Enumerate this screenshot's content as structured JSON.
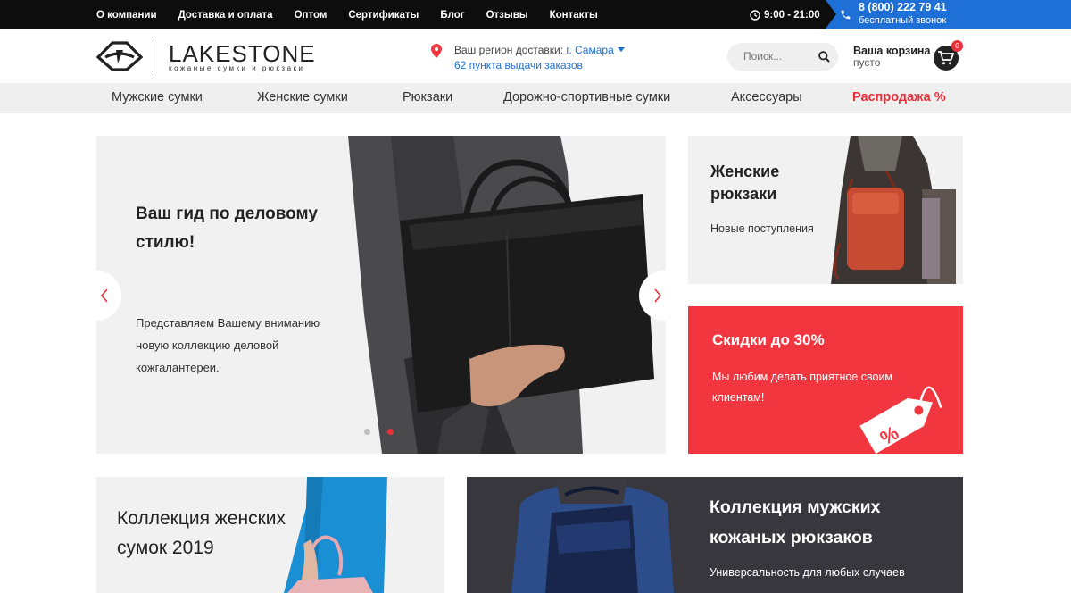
{
  "topbar": {
    "links": [
      "О компании",
      "Доставка и оплата",
      "Оптом",
      "Сертификаты",
      "Блог",
      "Отзывы",
      "Контакты"
    ],
    "hours": "9:00 - 21:00",
    "phone": "8 (800) 222 79 41",
    "phone_sub": "бесплатный звонок"
  },
  "header": {
    "logo": "LAKESTONE",
    "logo_sub": "кожаные сумки и рюкзаки",
    "region_label": "Ваш регион доставки:",
    "region_city": "г. Самара",
    "pickup_points": "62 пункта выдачи заказов",
    "search_placeholder": "Поиск...",
    "cart_title": "Ваша корзина",
    "cart_status": "пусто",
    "cart_count": "0"
  },
  "categories": [
    "Мужские сумки",
    "Женские сумки",
    "Рюкзаки",
    "Дорожно-спортивные сумки",
    "Аксессуары",
    "Распродажа %"
  ],
  "hero": {
    "title": "Ваш гид по деловому стилю!",
    "text": "Представляем Вашему вниманию новую коллекцию деловой кожгалантереи.",
    "slides": 2,
    "active_slide": 2
  },
  "promos": {
    "women_backpacks_title": "Женские рюкзаки",
    "women_backpacks_sub": "Новые поступления",
    "sale_title": "Скидки до 30%",
    "sale_text": "Мы любим делать приятное своим клиентам!",
    "sale_tag": "%"
  },
  "tiles": {
    "women_bags": "Коллекция женских сумок 2019",
    "men_backpacks": "Коллекция мужских кожаных рюкзаков",
    "men_backpacks_sub": "Универсальность для любых случаев"
  },
  "colors": {
    "accent_blue": "#1e6fd6",
    "accent_red": "#f2363f",
    "topbar": "#0d0d0d"
  }
}
